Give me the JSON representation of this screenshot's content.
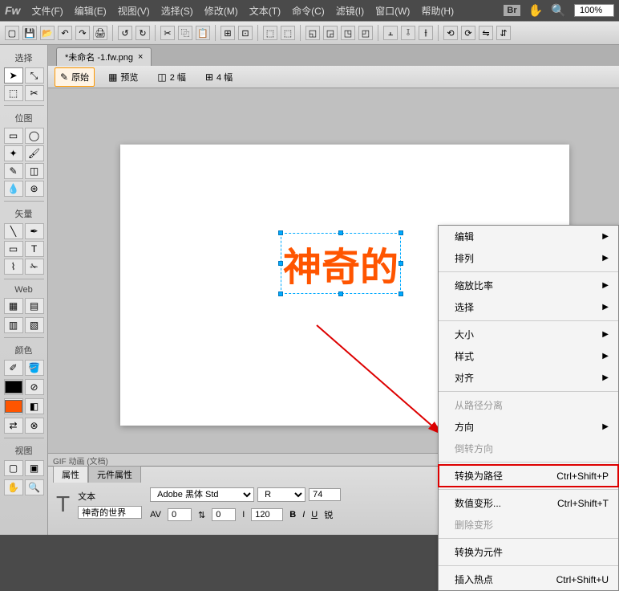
{
  "menubar": {
    "logo": "Fw",
    "items": [
      "文件(F)",
      "编辑(E)",
      "视图(V)",
      "选择(S)",
      "修改(M)",
      "文本(T)",
      "命令(C)",
      "滤镜(I)",
      "窗口(W)",
      "帮助(H)"
    ],
    "zoom": "100%",
    "br": "Br"
  },
  "tab": {
    "title": "*未命名 -1.fw.png",
    "close": "×"
  },
  "viewbar": {
    "original": "原始",
    "preview": "预览",
    "two": "2 幅",
    "four": "4 幅"
  },
  "canvas_text": "神奇的",
  "status": "GIF 动画 (文档)",
  "context": {
    "edit": "编辑",
    "arrange": "排列",
    "scale": "缩放比率",
    "select": "选择",
    "size": "大小",
    "style": "样式",
    "align": "对齐",
    "detach_path": "从路径分离",
    "direction": "方向",
    "reverse": "倒转方向",
    "convert_path": "转换为路径",
    "convert_path_key": "Ctrl+Shift+P",
    "num_transform": "数值变形...",
    "num_transform_key": "Ctrl+Shift+T",
    "remove_transform": "删除变形",
    "convert_symbol": "转换为元件",
    "insert_hotspot": "插入热点",
    "insert_hotspot_key": "Ctrl+Shift+U"
  },
  "left": {
    "select": "选择",
    "bitmap": "位图",
    "vector": "矢量",
    "web": "Web",
    "color": "颜色",
    "view": "视图"
  },
  "bottom": {
    "tab1": "属性",
    "tab2": "元件属性",
    "label_text": "文本",
    "text_value": "神奇的世界",
    "font": "Adobe 黑体 Std",
    "style": "R",
    "size": "74",
    "av": "AV",
    "spacing1": "0",
    "spacing2": "0",
    "height": "120",
    "sharp": "锐"
  }
}
